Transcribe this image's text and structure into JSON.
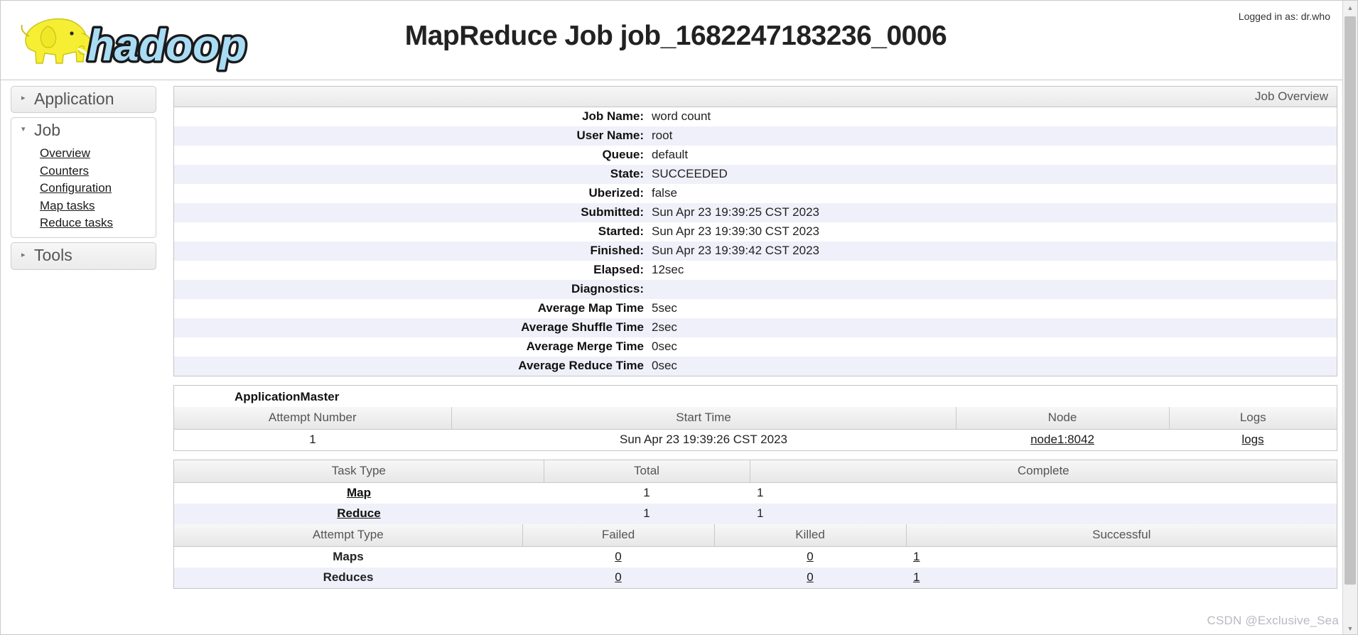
{
  "header": {
    "logo_alt": "hadoop",
    "title": "MapReduce Job job_1682247183236_0006",
    "logged_in": "Logged in as: dr.who"
  },
  "sidebar": {
    "sections": [
      {
        "label": "Application",
        "expanded": false,
        "arrow": "▸",
        "links": []
      },
      {
        "label": "Job",
        "expanded": true,
        "arrow": "▾",
        "links": [
          "Overview",
          "Counters",
          "Configuration",
          "Map tasks",
          "Reduce tasks"
        ]
      },
      {
        "label": "Tools",
        "expanded": false,
        "arrow": "▸",
        "links": []
      }
    ]
  },
  "overview": {
    "caption": "Job Overview",
    "rows": [
      {
        "key": "Job Name:",
        "value": "word count"
      },
      {
        "key": "User Name:",
        "value": "root"
      },
      {
        "key": "Queue:",
        "value": "default"
      },
      {
        "key": "State:",
        "value": "SUCCEEDED"
      },
      {
        "key": "Uberized:",
        "value": "false"
      },
      {
        "key": "Submitted:",
        "value": "Sun Apr 23 19:39:25 CST 2023"
      },
      {
        "key": "Started:",
        "value": "Sun Apr 23 19:39:30 CST 2023"
      },
      {
        "key": "Finished:",
        "value": "Sun Apr 23 19:39:42 CST 2023"
      },
      {
        "key": "Elapsed:",
        "value": "12sec"
      },
      {
        "key": "Diagnostics:",
        "value": ""
      },
      {
        "key": "Average Map Time",
        "value": "5sec"
      },
      {
        "key": "Average Shuffle Time",
        "value": "2sec"
      },
      {
        "key": "Average Merge Time",
        "value": "0sec"
      },
      {
        "key": "Average Reduce Time",
        "value": "0sec"
      }
    ]
  },
  "app_master": {
    "title": "ApplicationMaster",
    "headers": [
      "Attempt Number",
      "Start Time",
      "Node",
      "Logs"
    ],
    "row": {
      "attempt_number": "1",
      "start_time": "Sun Apr 23 19:39:26 CST 2023",
      "node": "node1:8042",
      "logs": "logs"
    }
  },
  "tasks": {
    "headers": [
      "Task Type",
      "Total",
      "Complete"
    ],
    "rows": [
      {
        "task_type": "Map",
        "total": "1",
        "complete": "1"
      },
      {
        "task_type": "Reduce",
        "total": "1",
        "complete": "1"
      }
    ]
  },
  "attempts": {
    "headers": [
      "Attempt Type",
      "Failed",
      "Killed",
      "Successful"
    ],
    "rows": [
      {
        "attempt_type": "Maps",
        "failed": "0",
        "killed": "0",
        "successful": "1"
      },
      {
        "attempt_type": "Reduces",
        "failed": "0",
        "killed": "0",
        "successful": "1"
      }
    ]
  },
  "watermark": "CSDN @Exclusive_Sea"
}
